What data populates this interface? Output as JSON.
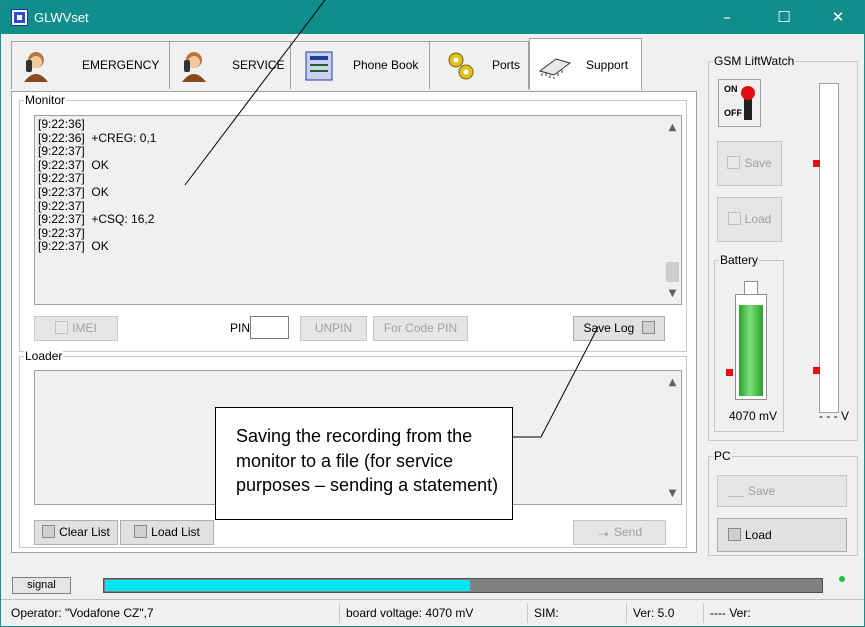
{
  "window": {
    "title": "GLWVset",
    "controls": {
      "minimize": "–",
      "maximize": "☐",
      "close": "✕"
    }
  },
  "tabs": [
    {
      "label": "EMERGENCY",
      "icon": "person-phone-icon"
    },
    {
      "label": "SERVICE",
      "icon": "person-phone-icon"
    },
    {
      "label": "Phone Book",
      "icon": "phone-book-icon"
    },
    {
      "label": "Ports",
      "icon": "gears-icon"
    },
    {
      "label": "Support",
      "icon": "chip-icon",
      "active": true
    }
  ],
  "monitor": {
    "label": "Monitor",
    "lines": [
      "[9:22:36]",
      "[9:22:36]  +CREG: 0,1",
      "[9:22:37]",
      "[9:22:37]  OK",
      "[9:22:37]",
      "[9:22:37]  OK",
      "[9:22:37]",
      "[9:22:37]  +CSQ: 16,2",
      "[9:22:37]",
      "[9:22:37]  OK"
    ],
    "buttons": {
      "imei": "IMEI",
      "pin_label": "PIN",
      "pin_value": "",
      "unpin": "UNPIN",
      "for_code_pin": "For Code PIN",
      "save_log": "Save Log"
    }
  },
  "loader": {
    "label": "Loader",
    "buttons": {
      "clear_list": "Clear List",
      "load_list": "Load List",
      "send": "Send"
    }
  },
  "gsm_liftwatch": {
    "label": "GSM LiftWatch",
    "switch": {
      "on": "ON",
      "off": "OFF"
    },
    "save": "Save",
    "load": "Load",
    "battery": {
      "label": "Battery",
      "value": "4070 mV",
      "fill_fraction": 0.93
    },
    "voltage_value": "- - - V"
  },
  "pc": {
    "label": "PC",
    "save": "Save",
    "load": "Load"
  },
  "signal": {
    "label": "signal",
    "fill_fraction": 0.51
  },
  "status": {
    "operator": "Operator: \"Vodafone CZ\",7",
    "board_voltage": "board voltage: 4070 mV",
    "sim": "SIM:",
    "ver": "Ver: 5.0",
    "ver2": "---- Ver:"
  },
  "callout": {
    "text": "Saving the recording from the monitor to a file (for service purposes – sending a statement)"
  },
  "colors": {
    "titlebar": "#0f8e8c",
    "signal_fill": "#00e5f2",
    "battery": "#2aa02a",
    "marker": "#e01010"
  }
}
